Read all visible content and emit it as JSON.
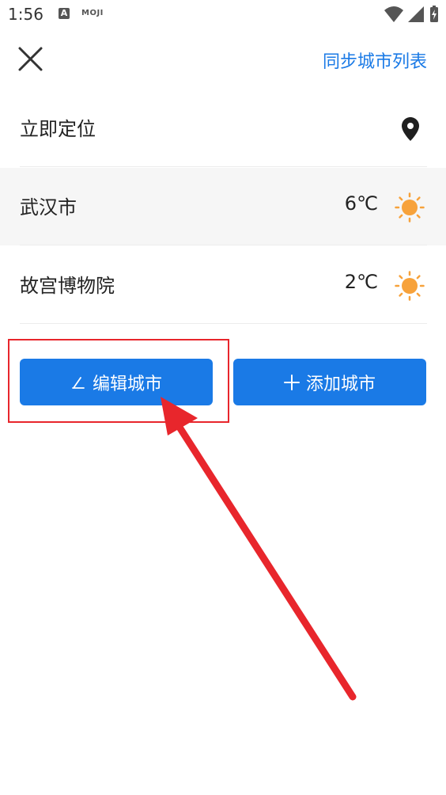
{
  "status_bar": {
    "time": "1:56",
    "notif_a": "A",
    "notif_app": "MOJI"
  },
  "header": {
    "close_icon": "close-icon",
    "sync_label": "同步城市列表"
  },
  "locate_row": {
    "label": "立即定位",
    "icon": "location-pin-icon"
  },
  "cities": [
    {
      "name": "武汉市",
      "temp": "6℃",
      "icon": "sun-icon",
      "highlighted": true
    },
    {
      "name": "故宫博物院",
      "temp": "2℃",
      "icon": "sun-icon",
      "highlighted": false
    }
  ],
  "buttons": {
    "edit_label": "编辑城市",
    "add_label": "添加城市"
  },
  "colors": {
    "accent": "#1a7ae6",
    "sun": "#f7a23b",
    "annotation": "#e8262c"
  }
}
